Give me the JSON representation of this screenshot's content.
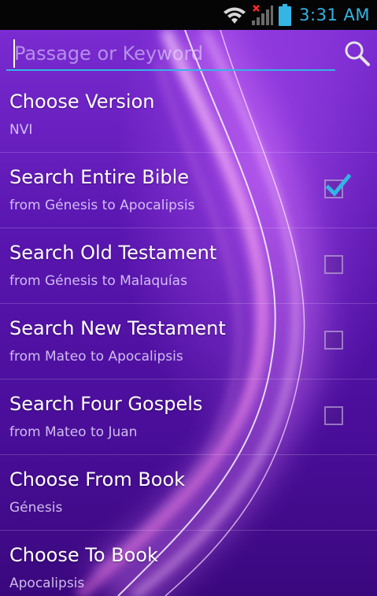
{
  "status_bar": {
    "time": "3:31 AM",
    "icons": [
      "wifi-icon",
      "signal-icon",
      "battery-icon"
    ],
    "accent_color": "#33b5e5"
  },
  "search": {
    "placeholder": "Passage or Keyword",
    "value": "",
    "icon": "search-icon"
  },
  "options": [
    {
      "title": "Choose Version",
      "subtitle": "NVI",
      "has_checkbox": false
    },
    {
      "title": "Search Entire Bible",
      "subtitle": "from Génesis to Apocalipsis",
      "has_checkbox": true,
      "checked": true
    },
    {
      "title": "Search Old Testament",
      "subtitle": "from Génesis to Malaquías",
      "has_checkbox": true,
      "checked": false
    },
    {
      "title": "Search New Testament",
      "subtitle": "from Mateo to Apocalipsis",
      "has_checkbox": true,
      "checked": false
    },
    {
      "title": "Search Four Gospels",
      "subtitle": "from Mateo to Juan",
      "has_checkbox": true,
      "checked": false
    },
    {
      "title": "Choose From Book",
      "subtitle": "Génesis",
      "has_checkbox": false
    },
    {
      "title": "Choose To Book",
      "subtitle": "Apocalipsis",
      "has_checkbox": false
    }
  ],
  "colors": {
    "background": "#5a16b0",
    "accent": "#33b5e5",
    "text": "#ffffff"
  }
}
